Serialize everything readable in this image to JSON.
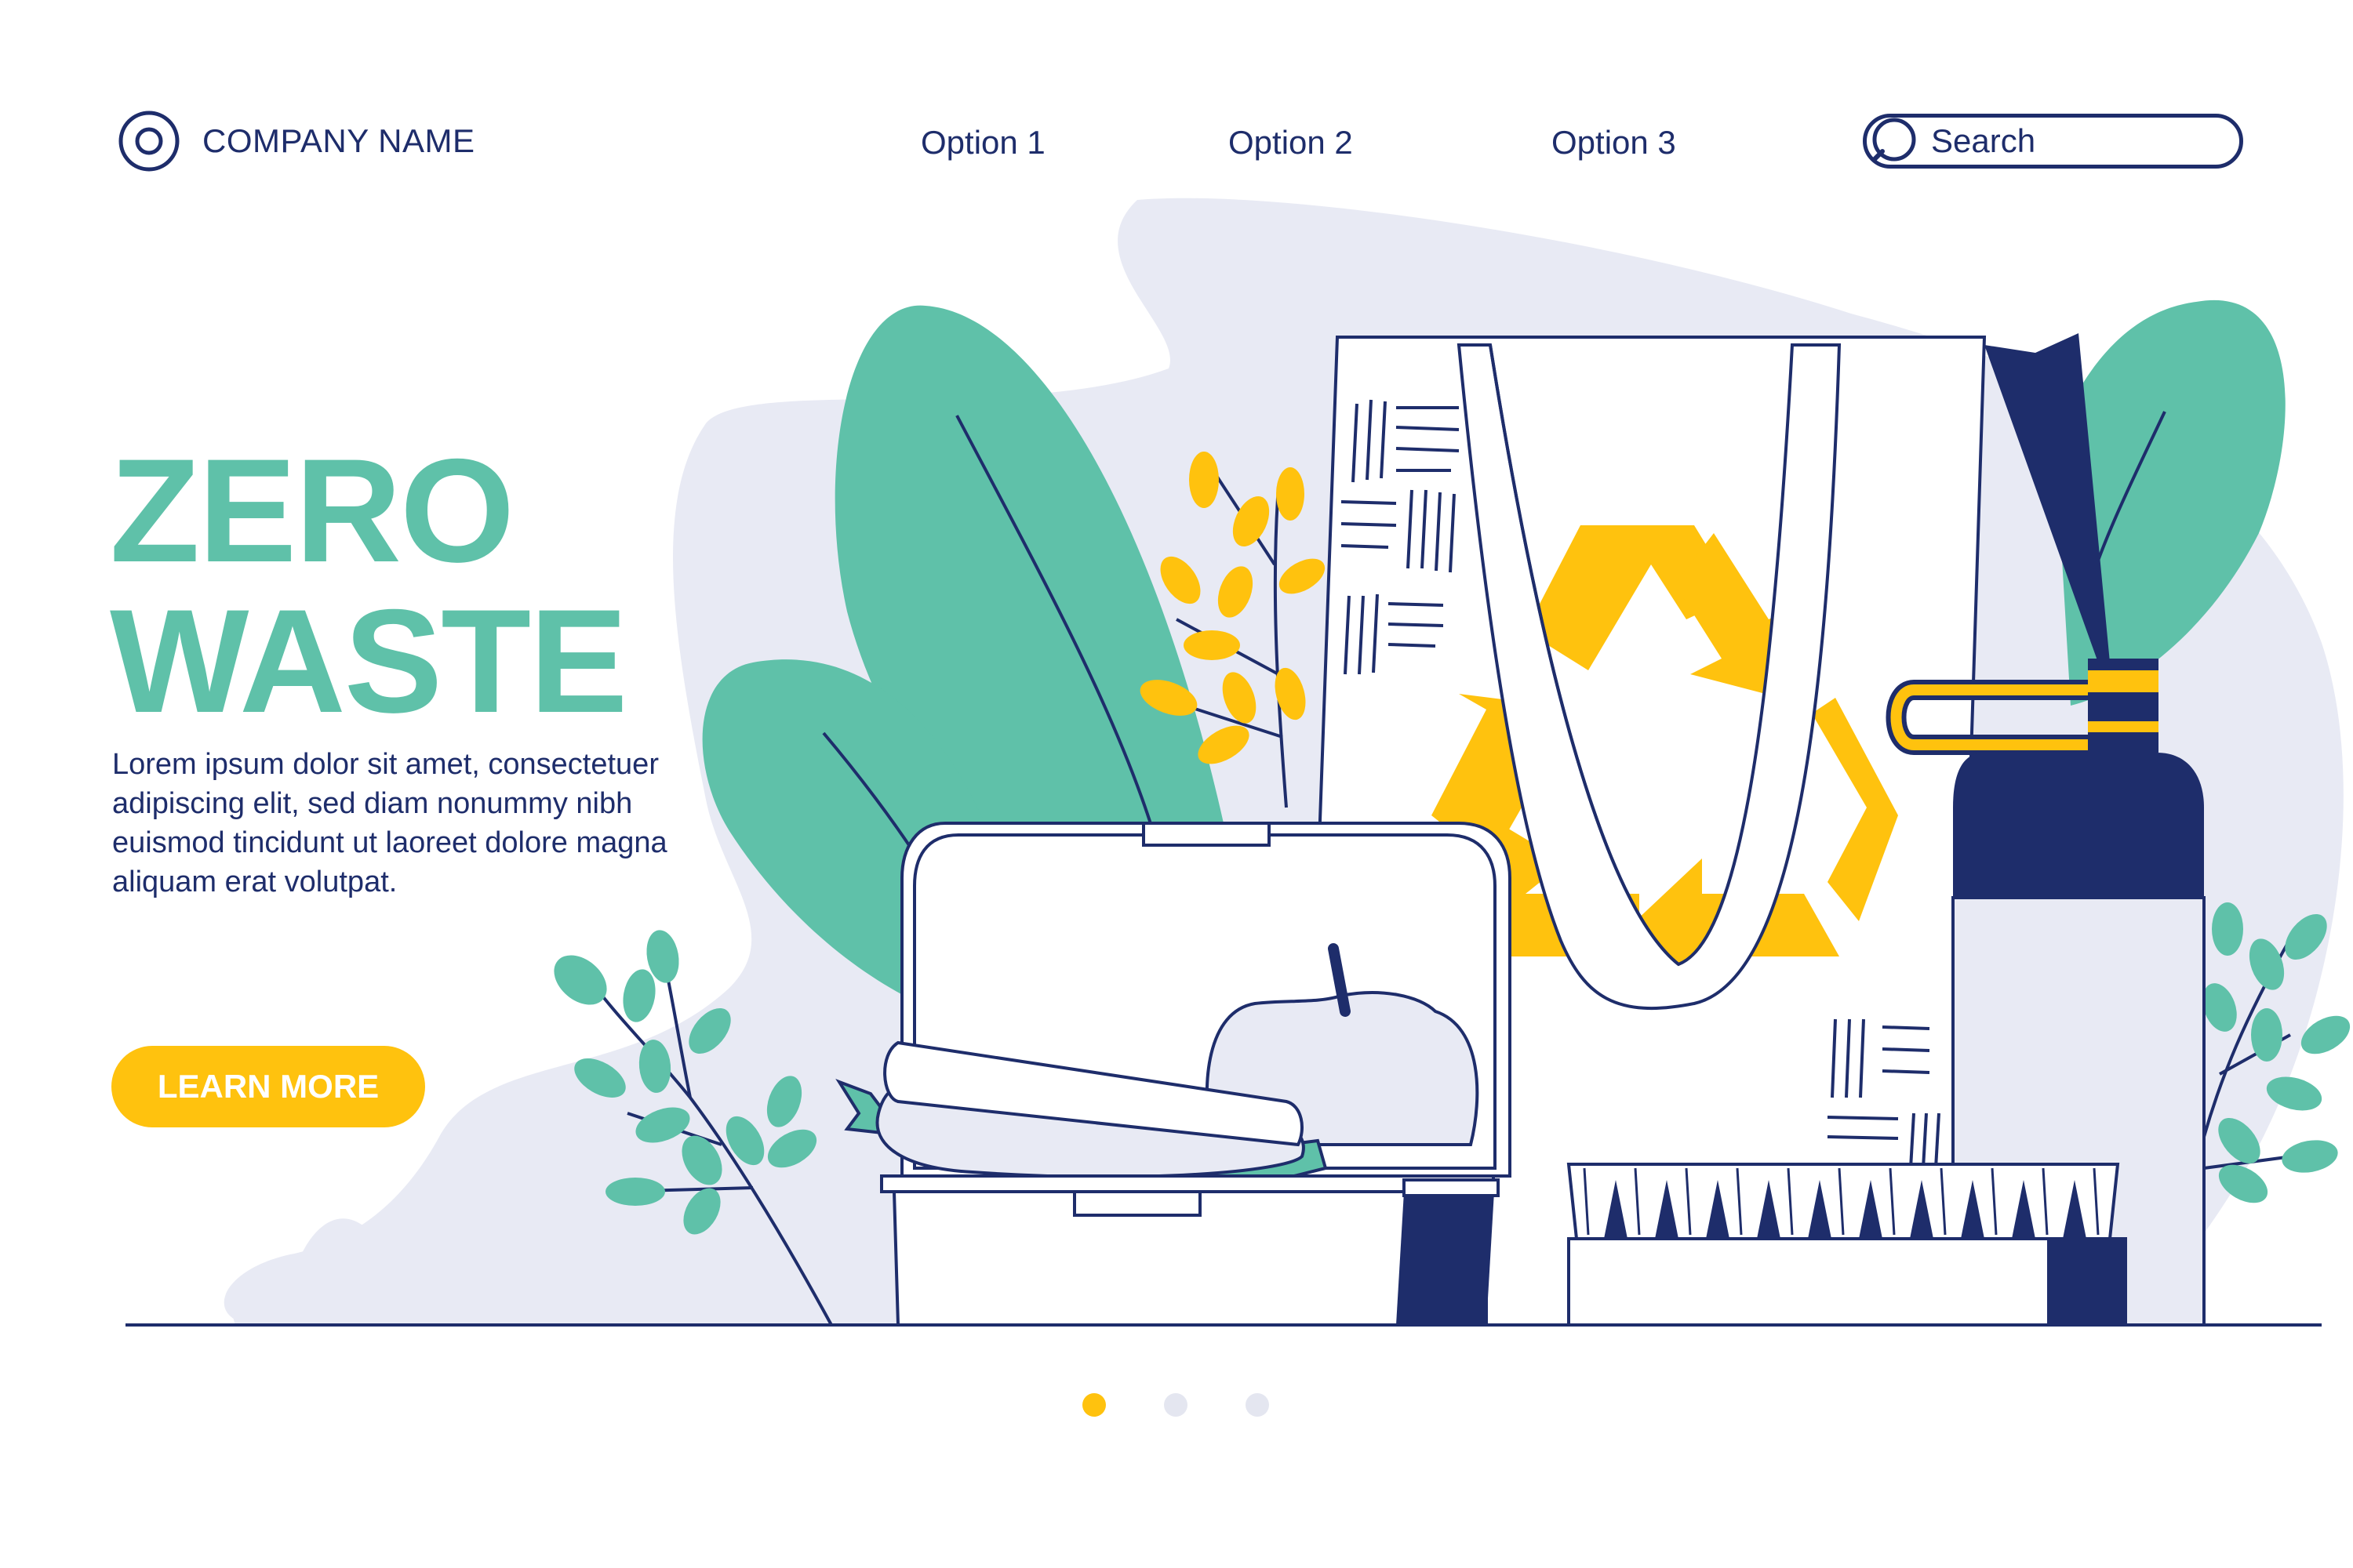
{
  "brand": {
    "company_name": "COMPANY NAME"
  },
  "nav": {
    "options": [
      "Option 1",
      "Option 2",
      "Option 3"
    ]
  },
  "search": {
    "label": "Search"
  },
  "hero": {
    "title_line1": "ZERO",
    "title_line2": "WASTE",
    "description": "Lorem ipsum dolor sit amet, consectetuer adipiscing elit, sed diam nonummy nibh euismod tincidunt ut laoreet dolore magna aliquam erat volutpat.",
    "cta_label": "LEARN MORE"
  },
  "carousel": {
    "slide_count": 3,
    "active_index": 0
  },
  "colors": {
    "navy": "#1e2d6b",
    "teal": "#5fc1a9",
    "yellow": "#ffc20e",
    "blob": "#e8eaf4",
    "dot_inactive": "#e4e6f0"
  },
  "icons": [
    "logo-ring-icon",
    "search-icon",
    "recycle-icon"
  ]
}
